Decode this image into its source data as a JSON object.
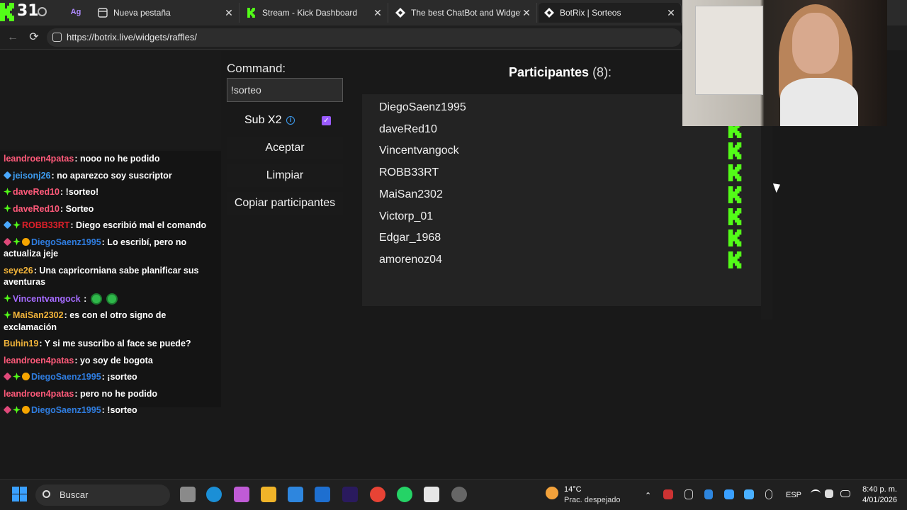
{
  "browser": {
    "kick_count": "31",
    "tabs": [
      {
        "label": "Nueva pestaña",
        "close": "✕"
      },
      {
        "label": "Stream - Kick Dashboard",
        "close": "✕"
      },
      {
        "label": "The best ChatBot and Widgets for",
        "close": "✕"
      },
      {
        "label": "BotRix | Sorteos",
        "close": "✕"
      }
    ],
    "url": "https://botrix.live/widgets/raffles/",
    "pinned_icon_text": "Ag"
  },
  "chat": {
    "messages": [
      {
        "badges": [],
        "user": "leandroen4patas",
        "color": "#ff5a7a",
        "text": ": nooo no he podido"
      },
      {
        "badges": [
          "gem"
        ],
        "user": "jeisonj26",
        "color": "#3d9cf0",
        "text": ": no aparezco soy suscriptor"
      },
      {
        "badges": [
          "og"
        ],
        "user": "daveRed10",
        "color": "#ff5a7a",
        "text": ": !sorteo!"
      },
      {
        "badges": [
          "og"
        ],
        "user": "daveRed10",
        "color": "#ff5a7a",
        "text": ": Sorteo"
      },
      {
        "badges": [
          "gem",
          "og"
        ],
        "user": "ROBB33RT",
        "color": "#e0202a",
        "text": ": Diego escribió mal el comando"
      },
      {
        "badges": [
          "sub",
          "og",
          "vip"
        ],
        "user": "DiegoSaenz1995",
        "color": "#2f7de0",
        "text": ": Lo escribí, pero no actualiza jeje"
      },
      {
        "badges": [],
        "user": "seye26",
        "color": "#f2b43a",
        "text": ": Una capricorniana sabe planificar sus aventuras"
      },
      {
        "badges": [
          "og"
        ],
        "user": "Vincentvangock",
        "color": "#a56bff",
        "text": " :"
      },
      {
        "badges": [
          "og"
        ],
        "user": "MaiSan2302",
        "color": "#f2b43a",
        "text": ": es con el otro signo de exclamación"
      },
      {
        "badges": [],
        "user": "Buhin19",
        "color": "#f2b43a",
        "text": ": Y si me suscribo al face se puede?"
      },
      {
        "badges": [],
        "user": "leandroen4patas",
        "color": "#ff5a7a",
        "text": ": yo soy de bogota"
      },
      {
        "badges": [
          "sub",
          "og",
          "vip"
        ],
        "user": "DiegoSaenz1995",
        "color": "#2f7de0",
        "text": ": ¡sorteo"
      },
      {
        "badges": [],
        "user": "leandroen4patas",
        "color": "#ff5a7a",
        "text": ": pero no he podido"
      },
      {
        "badges": [
          "sub",
          "og",
          "vip"
        ],
        "user": "DiegoSaenz1995",
        "color": "#2f7de0",
        "text": ": !sorteo"
      }
    ]
  },
  "raffle": {
    "command_label": "Command:",
    "command_value": "!sorteo",
    "sub_label": "Sub X2",
    "sub_checked": true,
    "accept_button": "Aceptar",
    "clear_button": "Limpiar",
    "copy_button": "Copiar participantes",
    "participants_title": "Participantes",
    "participants_count": "(8):",
    "participants": [
      "DiegoSaenz1995",
      "daveRed10",
      "Vincentvangock",
      "ROBB33RT",
      "MaiSan2302",
      "Victorp_01",
      "Edgar_1968",
      "amorenoz04"
    ]
  },
  "taskbar": {
    "search_placeholder": "Buscar",
    "weather_temp": "14°C",
    "weather_desc": "Prac. despejado",
    "lang": "ESP",
    "time": "8:40 p. m.",
    "date": "4/01/2026"
  },
  "colors": {
    "kick_green": "#53fc18",
    "accent_purple": "#9a5bff"
  }
}
